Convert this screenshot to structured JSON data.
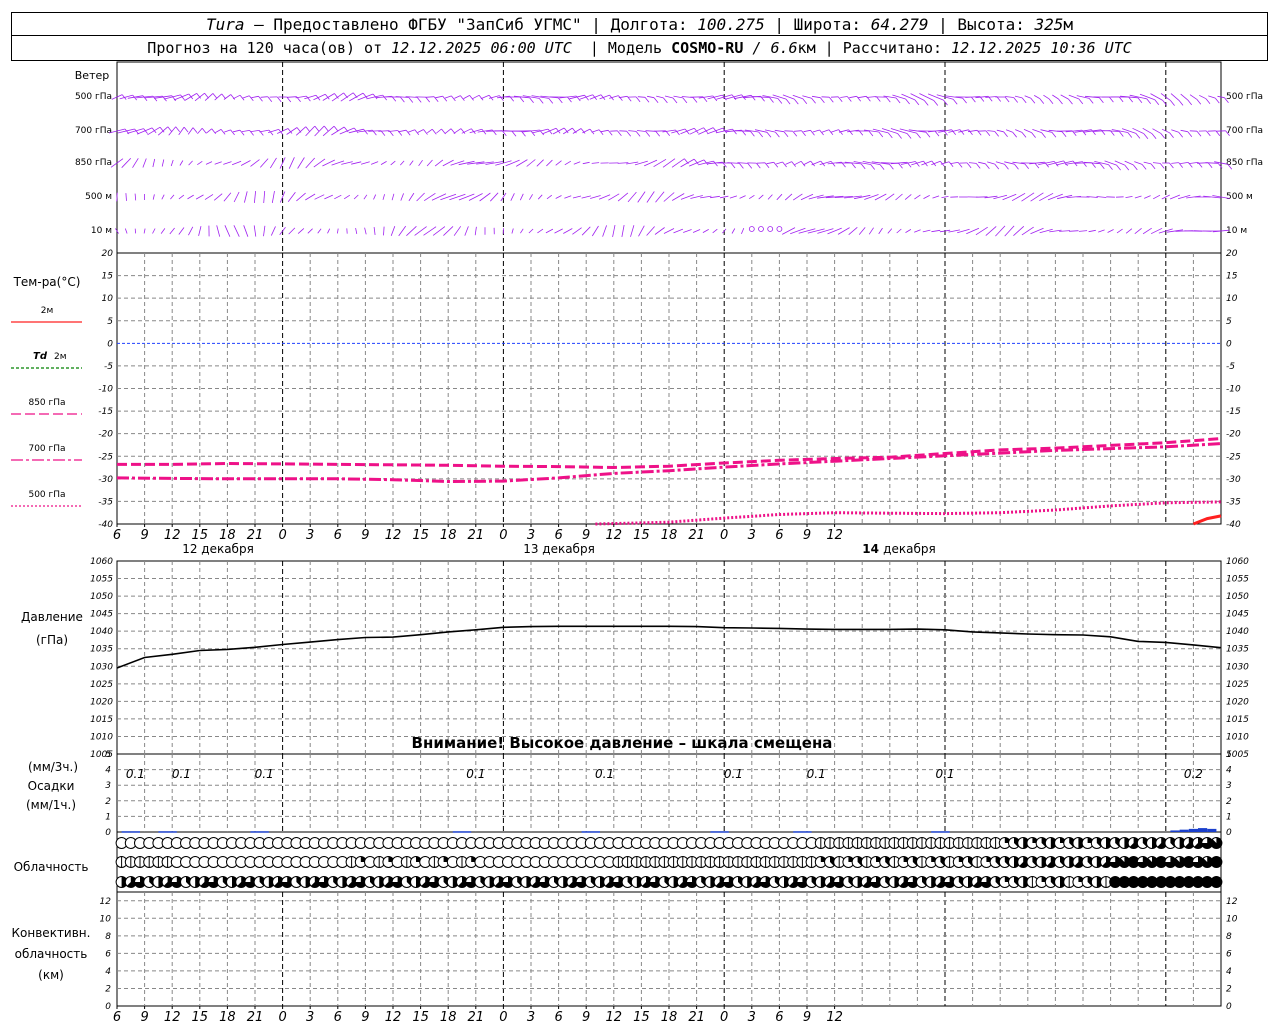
{
  "header": {
    "station": "Tura",
    "dash": "–",
    "provider": "Предоставлено ФГБУ \"ЗапСиб УГМС\"",
    "lon_label": "Долгота:",
    "lon_value": "100.275",
    "lat_label": "Широта:",
    "lat_value": "64.279",
    "alt_label": "Высота:",
    "alt_value": "325",
    "alt_unit": "м",
    "sep": "|",
    "forecast_label": "Прогноз на 120 часа(ов) от",
    "forecast_time": "12.12.2025 06:00 UTC",
    "model_label": "Модель",
    "model_name": "COSMO-RU",
    "model_slash": "/",
    "model_res": "6.6",
    "model_res_unit": "км",
    "calc_label": "Рассчитано:",
    "calc_time": "12.12.2025 10:36 UTC"
  },
  "colors": {
    "wind": "#a020f0",
    "t2m": "#ff2020",
    "td2m": "#008000",
    "temp_levels": "#ee1188",
    "zero_line": "#2040ff",
    "pressure": "#000000",
    "precip": "#1a3fcc",
    "grid": "#888888"
  },
  "chart_data": [
    {
      "type": "wind-barbs",
      "panel": "wind",
      "title": "Ветер",
      "levels": [
        "500 гПа",
        "700 гПа",
        "850 гПа",
        "500 м",
        "10 м"
      ],
      "x_hours": [
        0,
        120
      ],
      "step_hours": 1
    },
    {
      "type": "line",
      "panel": "temperature",
      "title": "Тем-ра(°C)",
      "ylim": [
        -40,
        20
      ],
      "yticks": [
        20,
        15,
        10,
        5,
        0,
        -5,
        -10,
        -15,
        -20,
        -25,
        -30,
        -35,
        -40
      ],
      "legend": [
        {
          "label": "2м",
          "style": "solid",
          "color": "#ff2020"
        },
        {
          "label_prefix": "Td",
          "label": "2м",
          "style": "dashed",
          "color": "#008000"
        },
        {
          "label": "850 гПа",
          "style": "dash-long",
          "color": "#ee1188"
        },
        {
          "label": "700 гПа",
          "style": "dash-dot",
          "color": "#ee1188"
        },
        {
          "label": "500 гПа",
          "style": "dotted",
          "color": "#ee1188"
        }
      ],
      "series": [
        {
          "name": "850 гПа",
          "style": "dash-long",
          "x": [
            0,
            6,
            12,
            18,
            24,
            30,
            36,
            42,
            48,
            54,
            60,
            66,
            72,
            78,
            84,
            90,
            96,
            102,
            108,
            114,
            120
          ],
          "values": [
            -26.8,
            -26.8,
            -26.6,
            -26.7,
            -26.8,
            -26.9,
            -27,
            -27.2,
            -27.3,
            -27.5,
            -27.2,
            -26.5,
            -25.9,
            -25.5,
            -25.2,
            -24.4,
            -23.6,
            -23.2,
            -22.6,
            -22,
            -21.1
          ]
        },
        {
          "name": "700 гПа",
          "style": "dash-dot",
          "x": [
            0,
            6,
            12,
            18,
            24,
            30,
            36,
            42,
            48,
            54,
            60,
            66,
            72,
            78,
            84,
            90,
            96,
            102,
            108,
            114,
            120
          ],
          "values": [
            -29.8,
            -29.9,
            -30,
            -30,
            -30,
            -30.2,
            -30.6,
            -30.5,
            -29.8,
            -28.8,
            -28.2,
            -27.4,
            -26.7,
            -26.1,
            -25.5,
            -24.9,
            -24.3,
            -23.7,
            -23.3,
            -22.9,
            -22.2
          ]
        },
        {
          "name": "500 гПа",
          "style": "dotted",
          "x": [
            52,
            60,
            66,
            72,
            78,
            84,
            90,
            96,
            102,
            108,
            114,
            120
          ],
          "values": [
            -40,
            -39.6,
            -38.7,
            -37.9,
            -37.5,
            -37.6,
            -37.7,
            -37.5,
            -36.9,
            -36,
            -35.3,
            -35.1
          ]
        },
        {
          "name": "2м",
          "style": "solid",
          "x": [
            117,
            118.5,
            120
          ],
          "values": [
            -40,
            -38.8,
            -38.2
          ]
        }
      ]
    },
    {
      "type": "line",
      "panel": "pressure",
      "title": "Давление",
      "ylabel": "(гПа)",
      "ylim": [
        1005,
        1060
      ],
      "yticks": [
        1060,
        1055,
        1050,
        1045,
        1040,
        1035,
        1030,
        1025,
        1020,
        1015,
        1010,
        1005
      ],
      "note": "Внимание! Высокое давление – шкала смещена",
      "series": [
        {
          "name": "Давление",
          "x": [
            0,
            3,
            6,
            9,
            12,
            15,
            18,
            21,
            24,
            27,
            30,
            33,
            36,
            39,
            42,
            45,
            48,
            51,
            54,
            57,
            60,
            63,
            66,
            69,
            72,
            75,
            78,
            81,
            84,
            87,
            90,
            93,
            96,
            99,
            102,
            105,
            108,
            111,
            114,
            117,
            120
          ],
          "values": [
            1029.5,
            1032.5,
            1033.4,
            1034.5,
            1034.8,
            1035.4,
            1036.2,
            1036.9,
            1037.6,
            1038.2,
            1038.3,
            1039,
            1039.8,
            1040.4,
            1041.1,
            1041.3,
            1041.4,
            1041.4,
            1041.4,
            1041.4,
            1041.4,
            1041.3,
            1041,
            1040.9,
            1040.8,
            1040.6,
            1040.5,
            1040.5,
            1040.5,
            1040.6,
            1040.4,
            1039.8,
            1039.5,
            1039.2,
            1039,
            1038.9,
            1038.4,
            1037.1,
            1036.8,
            1036.1,
            1035.3
          ]
        }
      ]
    },
    {
      "type": "bar",
      "panel": "precipitation",
      "title": "Осадки",
      "ylabel_top": "(мм/3ч.)",
      "ylabel_bottom": "(мм/1ч.)",
      "ylim": [
        0,
        5
      ],
      "yticks": [
        5,
        4,
        3,
        2,
        1,
        0
      ],
      "labels": [
        {
          "hour": 2,
          "text": "0.1"
        },
        {
          "hour": 7,
          "text": "0.1"
        },
        {
          "hour": 16,
          "text": "0.1"
        },
        {
          "hour": 39,
          "text": "0.1"
        },
        {
          "hour": 53,
          "text": "0.1"
        },
        {
          "hour": 67,
          "text": "0.1"
        },
        {
          "hour": 76,
          "text": "0.1"
        },
        {
          "hour": 90,
          "text": "0.1"
        },
        {
          "hour": 117,
          "text": "0.2"
        }
      ],
      "values_x": [
        1,
        2,
        5,
        6,
        15,
        16,
        37,
        38,
        51,
        52,
        65,
        66,
        74,
        75,
        89,
        90,
        115,
        116,
        117,
        118,
        119
      ],
      "values": [
        0.05,
        0.05,
        0.05,
        0.05,
        0.05,
        0.05,
        0.05,
        0.05,
        0.05,
        0.05,
        0.05,
        0.05,
        0.05,
        0.05,
        0.05,
        0.05,
        0.1,
        0.15,
        0.2,
        0.25,
        0.2
      ]
    },
    {
      "type": "cloud-cover",
      "panel": "clouds",
      "title": "Облачность",
      "rows": [
        "high",
        "middle",
        "low"
      ],
      "step_hours": 1
    },
    {
      "type": "line",
      "panel": "convective",
      "title": "Конвективн. облачность (км)",
      "title_lines": [
        "Конвективн.",
        "облачность",
        "(км)"
      ],
      "ylim": [
        0,
        13
      ],
      "yticks": [
        12,
        10,
        8,
        6,
        4,
        2,
        0
      ],
      "series": []
    },
    {
      "type": "axis",
      "panel": "time-axis",
      "x_ticks": [
        "6",
        "9",
        "12",
        "15",
        "18",
        "21",
        "0",
        "3",
        "6",
        "9",
        "12",
        "15",
        "18",
        "21",
        "0",
        "3",
        "6",
        "9",
        "12",
        "15",
        "18",
        "21",
        "0",
        "3",
        "6",
        "9",
        "12"
      ],
      "days": [
        {
          "label": "12 декабря",
          "bold_day": false
        },
        {
          "label": "13 декабря",
          "bold_day": false
        },
        {
          "label": "14 декабря",
          "bold_day": true
        }
      ]
    }
  ]
}
